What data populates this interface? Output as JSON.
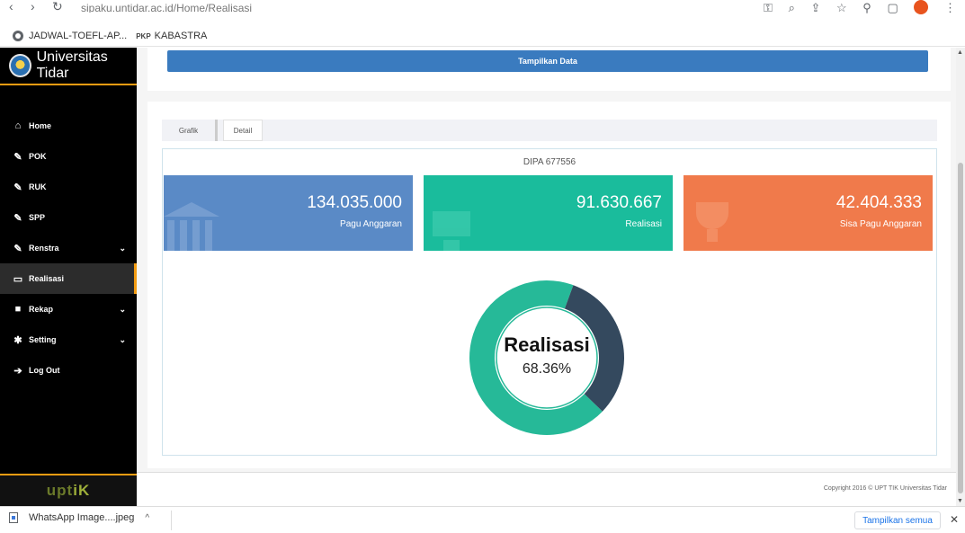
{
  "browser": {
    "url": "sipaku.untidar.ac.id/Home/Realisasi",
    "bookmarks": [
      {
        "label": "JADWAL-TOEFL-AP..."
      },
      {
        "label": "KABASTRA",
        "icon_text": "PKP"
      }
    ]
  },
  "sidebar": {
    "brand": "Universitas Tidar",
    "items": [
      {
        "label": "Home",
        "icon": "home-icon",
        "has_chevron": false
      },
      {
        "label": "POK",
        "icon": "edit-icon",
        "has_chevron": false
      },
      {
        "label": "RUK",
        "icon": "edit-icon",
        "has_chevron": false
      },
      {
        "label": "SPP",
        "icon": "edit-icon",
        "has_chevron": false
      },
      {
        "label": "Renstra",
        "icon": "edit-icon",
        "has_chevron": true
      },
      {
        "label": "Realisasi",
        "icon": "monitor-icon",
        "has_chevron": false,
        "active": true
      },
      {
        "label": "Rekap",
        "icon": "archive-icon",
        "has_chevron": true
      },
      {
        "label": "Setting",
        "icon": "gear-icon",
        "has_chevron": true
      },
      {
        "label": "Log Out",
        "icon": "sign-out-icon",
        "has_chevron": false
      }
    ],
    "footer_logo_a": "upt",
    "footer_logo_b": "iK"
  },
  "main": {
    "show_button": "Tampilkan Data",
    "tabs": [
      {
        "label": "Grafik"
      },
      {
        "label": "Detail"
      }
    ],
    "dipa": "DIPA 677556",
    "stats": [
      {
        "value": "134.035.000",
        "label": "Pagu Anggaran"
      },
      {
        "value": "91.630.667",
        "label": "Realisasi"
      },
      {
        "value": "42.404.333",
        "label": "Sisa Pagu Anggaran"
      }
    ],
    "donut": {
      "title": "Realisasi",
      "percent_text": "68.36%",
      "realisasi_fraction": 0.6836,
      "color_realisasi": "#26b998",
      "color_sisa": "#34495e"
    },
    "copyright": "Copyright 2016 © UPT TIK Universitas Tidar"
  },
  "download_bar": {
    "file": "WhatsApp Image....jpeg",
    "show_all": "Tampilkan semua"
  },
  "colors": {
    "sidebar_bg": "#000000",
    "accent": "#f39c12",
    "primary_button": "#3a7bbf",
    "stat_blue": "#5a8ac6",
    "stat_green": "#1abc9c",
    "stat_orange": "#f07a4b"
  }
}
